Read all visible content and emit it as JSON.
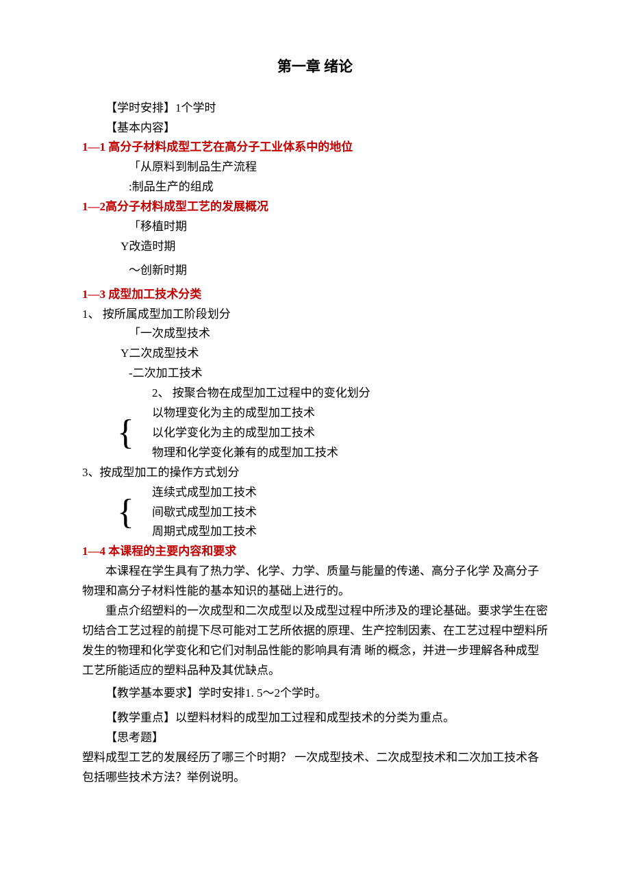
{
  "title": "第一章 绪论",
  "schedule_label": "【学时安排】",
  "schedule_value": "1个学时",
  "content_label": "【基本内容】",
  "s1": {
    "heading": "1—1 高分子材料成型工艺在高分子工业体系中的地位",
    "l1": "「从原料到制品生产流程",
    "l2": ":制品生产的组成"
  },
  "s2": {
    "heading": "1—2高分子材料成型工艺的发展概况",
    "l1": "「移植时期",
    "l2": "Y改造时期",
    "l3": "〜创新时期"
  },
  "s3": {
    "heading": "1—3 成型加工技术分类",
    "c1": {
      "label": "1、 按所属成型加工阶段划分",
      "l1": "「一次成型技术",
      "l2": "Y二次成型技术",
      "l3": "-二次加工技术"
    },
    "c2": {
      "label": "2、 按聚合物在成型加工过程中的变化划分",
      "l1": "以物理变化为主的成型加工技术",
      "l2": "以化学变化为主的成型加工技术",
      "l3": "物理和化学变化兼有的成型加工技术"
    },
    "c3": {
      "label": "3、按成型加工的操作方式划分",
      "l1": "连续式成型加工技术",
      "l2": "间歇式成型加工技术",
      "l3": "周期式成型加工技术"
    }
  },
  "s4": {
    "heading": "1—4 本课程的主要内容和要求",
    "p1": "本课程在学生具有了热力学、化学、力学、质量与能量的传递、高分子化学 及高分子物理和高分子材料性能的基本知识的基础上进行的。",
    "p2": "重点介绍塑料的一次成型和二次成型以及成型过程中所涉及的理论基础。要求学生在密切结合工艺过程的前提下尽可能对工艺所依据的原理、生产控制因素、在工艺过程中塑料所发生的物理和化学变化和它们对制品性能的影响具有清 晰的概念，并进一步理解各种成型工艺所能适应的塑料品种及其优缺点。"
  },
  "req_label": "【教学基本要求】",
  "req_value": "学时安排1. 5〜2个学时。",
  "focus_label": "【教学重点】",
  "focus_value": "以塑料材料的成型加工过程和成型技术的分类为重点。",
  "thinking_label": "【思考题】",
  "thinking_value": "塑料成型工艺的发展经历了哪三个时期？ 一次成型技术、二次成型技术和二次加工技术各包括哪些技术方法？举例说明。"
}
